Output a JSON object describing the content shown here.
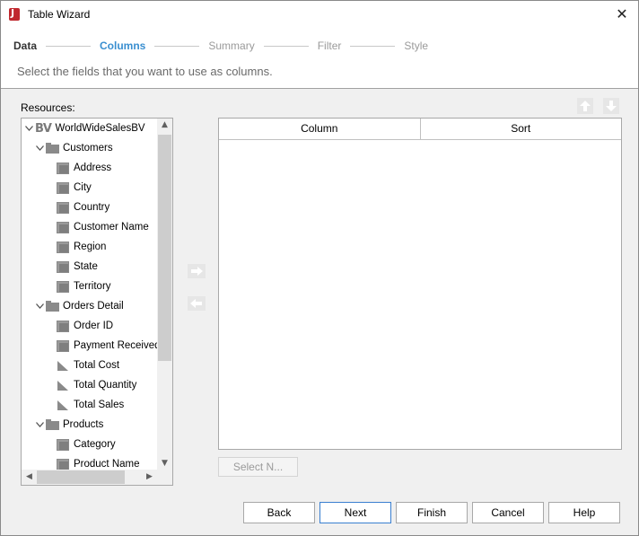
{
  "window": {
    "title": "Table Wizard"
  },
  "steps": [
    {
      "label": "Data",
      "state": "done"
    },
    {
      "label": "Columns",
      "state": "active"
    },
    {
      "label": "Summary",
      "state": "pending"
    },
    {
      "label": "Filter",
      "state": "pending"
    },
    {
      "label": "Style",
      "state": "pending"
    }
  ],
  "instruction": "Select the fields that you want to use as columns.",
  "resources": {
    "label": "Resources:",
    "tree": [
      {
        "label": "WorldWideSalesBV",
        "type": "bv",
        "level": 0,
        "expanded": true
      },
      {
        "label": "Customers",
        "type": "folder",
        "level": 1,
        "expanded": true
      },
      {
        "label": "Address",
        "type": "field",
        "level": 2
      },
      {
        "label": "City",
        "type": "field",
        "level": 2
      },
      {
        "label": "Country",
        "type": "field",
        "level": 2
      },
      {
        "label": "Customer Name",
        "type": "field",
        "level": 2
      },
      {
        "label": "Region",
        "type": "field",
        "level": 2
      },
      {
        "label": "State",
        "type": "field",
        "level": 2
      },
      {
        "label": "Territory",
        "type": "field",
        "level": 2
      },
      {
        "label": "Orders Detail",
        "type": "folder",
        "level": 1,
        "expanded": true
      },
      {
        "label": "Order ID",
        "type": "field",
        "level": 2
      },
      {
        "label": "Payment Received",
        "type": "field",
        "level": 2
      },
      {
        "label": "Total Cost",
        "type": "measure",
        "level": 2
      },
      {
        "label": "Total Quantity",
        "type": "measure",
        "level": 2
      },
      {
        "label": "Total Sales",
        "type": "measure",
        "level": 2
      },
      {
        "label": "Products",
        "type": "folder",
        "level": 1,
        "expanded": true
      },
      {
        "label": "Category",
        "type": "field",
        "level": 2
      },
      {
        "label": "Product Name",
        "type": "field",
        "level": 2
      }
    ]
  },
  "columns_table": {
    "headers": [
      "Column",
      "Sort"
    ],
    "rows": []
  },
  "select_button": "Select N...",
  "buttons": {
    "back": "Back",
    "next": "Next",
    "finish": "Finish",
    "cancel": "Cancel",
    "help": "Help"
  },
  "icons": {
    "app": "report-app-icon",
    "close": "close-icon",
    "add": "arrow-right-icon",
    "remove": "arrow-left-icon",
    "move_up": "arrow-up-icon",
    "move_down": "arrow-down-icon",
    "expand": "chevron-down-icon"
  },
  "colors": {
    "active_step": "#3a8fd0",
    "primary_border": "#3a7fd0",
    "icon_gray": "#8a8a8a"
  }
}
